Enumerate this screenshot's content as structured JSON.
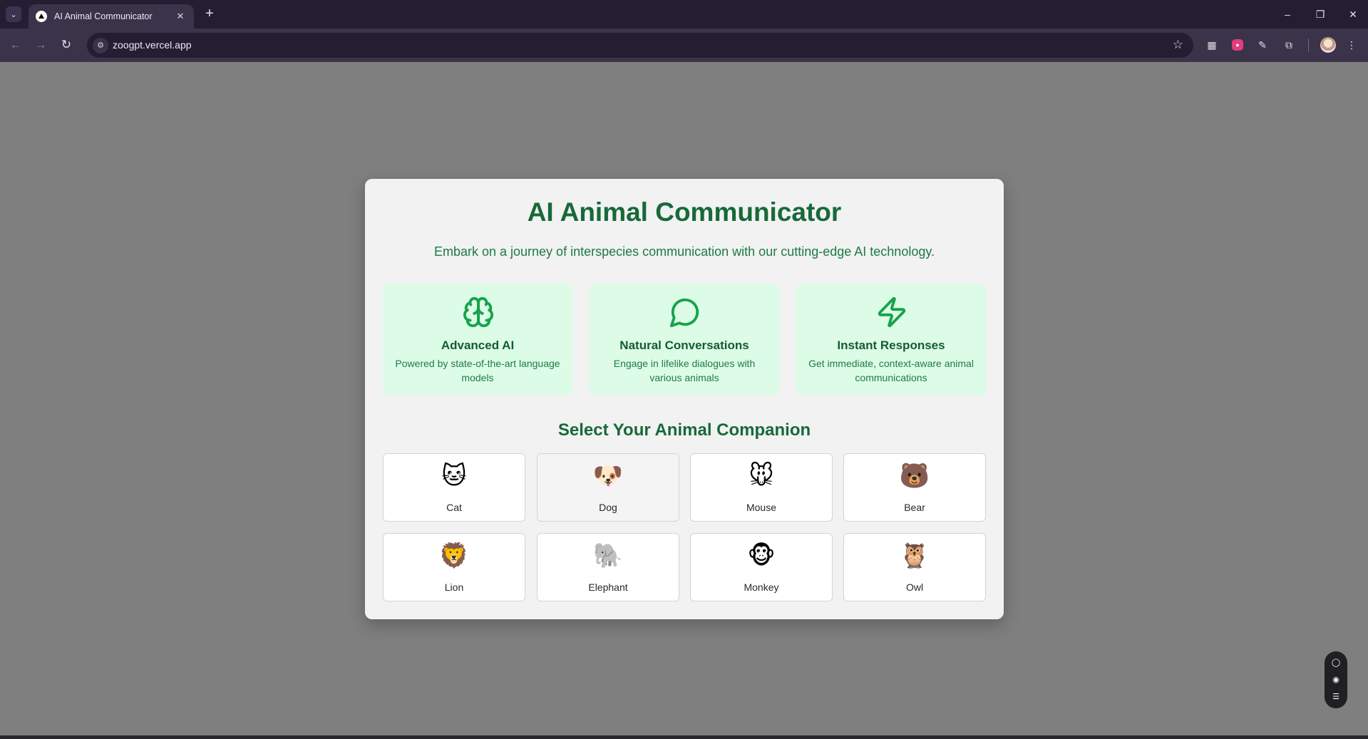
{
  "browser": {
    "tab_title": "AI Animal Communicator",
    "url": "zoogpt.vercel.app"
  },
  "page": {
    "title": "AI Animal Communicator",
    "subtitle": "Embark on a journey of interspecies communication with our cutting-edge AI technology.",
    "features": [
      {
        "icon": "brain-icon",
        "title": "Advanced AI",
        "desc": "Powered by state-of-the-art language models"
      },
      {
        "icon": "chat-bubble-icon",
        "title": "Natural Conversations",
        "desc": "Engage in lifelike dialogues with various animals"
      },
      {
        "icon": "lightning-icon",
        "title": "Instant Responses",
        "desc": "Get immediate, context-aware animal communications"
      }
    ],
    "section_title": "Select Your Animal Companion",
    "animals": [
      {
        "label": "Cat",
        "emoji": "🐱"
      },
      {
        "label": "Dog",
        "emoji": "🐶"
      },
      {
        "label": "Mouse",
        "emoji": "🐭"
      },
      {
        "label": "Bear",
        "emoji": "🐻"
      },
      {
        "label": "Lion",
        "emoji": "🦁"
      },
      {
        "label": "Elephant",
        "emoji": "🐘"
      },
      {
        "label": "Monkey",
        "emoji": "🐵"
      },
      {
        "label": "Owl",
        "emoji": "🦉"
      }
    ]
  },
  "colors": {
    "accent_green": "#17693a",
    "feature_bg": "#dcfce7",
    "icon_green": "#16a34a",
    "backdrop": "#7f7f7f"
  }
}
